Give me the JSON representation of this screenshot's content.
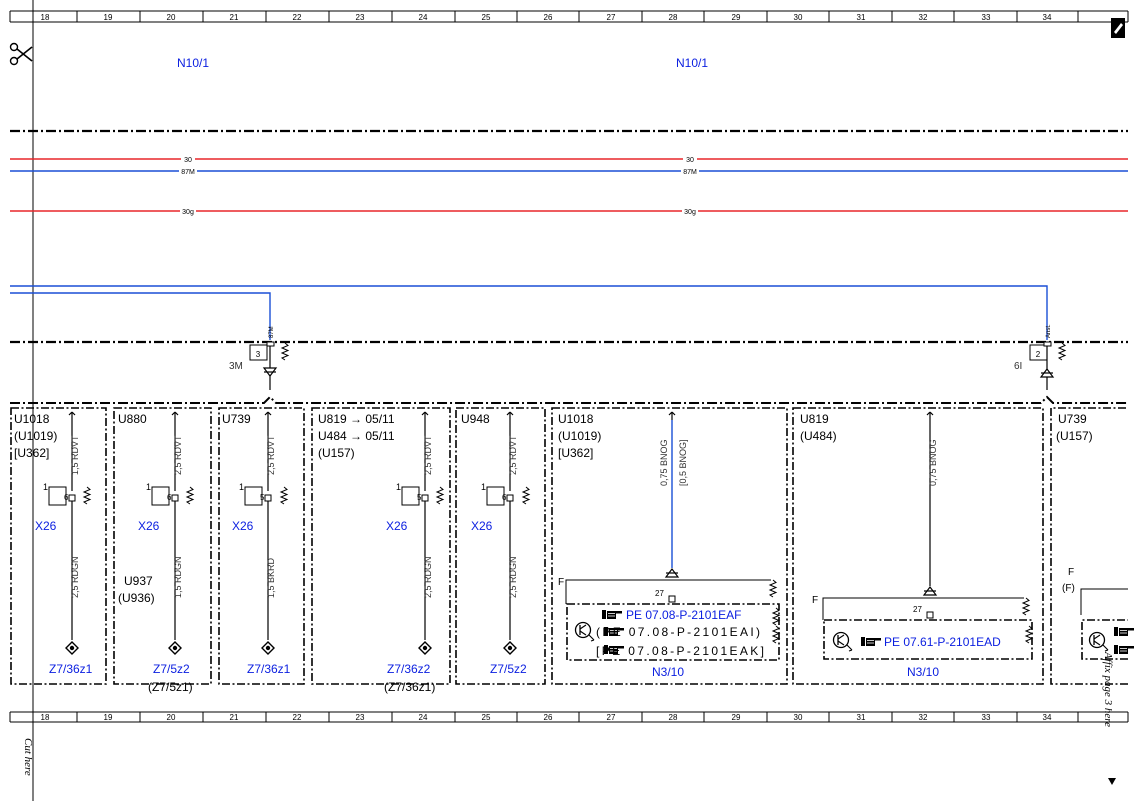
{
  "ruler": {
    "columns": [
      "18",
      "19",
      "20",
      "21",
      "22",
      "23",
      "24",
      "25",
      "26",
      "27",
      "28",
      "29",
      "30",
      "31",
      "32",
      "33",
      "34"
    ]
  },
  "modules": {
    "left": "N10/1",
    "right": "N10/1"
  },
  "buses": {
    "b30": "30",
    "b87m": "87M",
    "b30g": "30g"
  },
  "colors": {
    "red": "#e8262a",
    "blue": "#1a4fd6",
    "label_blue": "#0a1ee0"
  },
  "connectors": {
    "left": {
      "pin": "3",
      "name": "3M",
      "wire": "87M"
    },
    "right": {
      "pin": "2",
      "name": "6I",
      "wire": "Anst."
    }
  },
  "blocks": {
    "b1": {
      "l1": "U1018",
      "l2": "(U1019)",
      "l3": "[U362]",
      "wire_top": "1,5 RDVT",
      "pin": "6",
      "pin_side": "1",
      "conn": "X26",
      "wire_bot": "2,5 RDGN",
      "ground": "Z7/36z1"
    },
    "b2": {
      "l1": "U880",
      "wire_top": "2,5 RDVT",
      "pin": "6",
      "pin_side": "1",
      "conn": "X26",
      "var1": "U937",
      "var2": "(U936)",
      "wire_bot": "1,5 RDGN",
      "ground": "Z7/5z2",
      "ground2": "(Z7/5z1)"
    },
    "b3": {
      "l1": "U739",
      "wire_top": "2,5 RDVT",
      "pin": "5",
      "pin_side": "1",
      "conn": "X26",
      "wire_bot": "1,5 BKRD",
      "ground": "Z7/36z1"
    },
    "b4": {
      "l1": "U819 → 05/11",
      "l2": "U484 → 05/11",
      "l3": "(U157)",
      "wire_top": "2,5 RDVT",
      "pin": "5",
      "pin_side": "1",
      "conn": "X26",
      "wire_bot": "2,5 RDGN",
      "ground": "Z7/36z2",
      "ground2": "(Z7/36z1)"
    },
    "b5": {
      "l1": "U948",
      "wire_top": "2,5 RDVT",
      "pin": "6",
      "pin_side": "1",
      "conn": "X26",
      "wire_bot": "2,5 RDGN",
      "ground": "Z7/5z2"
    },
    "b6": {
      "l1": "U1018",
      "l2": "(U1019)",
      "l3": "[U362]",
      "wire_top": "0,75 BNOG",
      "wire_top2": "[0,5 BNOG]",
      "f": "F",
      "pin": "27",
      "pe1": "PE 07.08-P-2101EAF",
      "pe2": "(PE 07.08-P-2101EAI)",
      "pe3": "[PE 07.08-P-2101EAK]",
      "module": "N3/10"
    },
    "b7": {
      "l1": "U819",
      "l2": "(U484)",
      "wire_top": "0,75 BNOG",
      "f": "F",
      "pin": "27",
      "pe1": "PE 07.61-P-2101EAD",
      "module": "N3/10"
    },
    "b8": {
      "l1": "U739",
      "l2": "(U157)",
      "f": "F",
      "f2": "(F)"
    }
  },
  "margin": {
    "cut_here": "Cut here",
    "affix": "Affix page 3 here"
  }
}
